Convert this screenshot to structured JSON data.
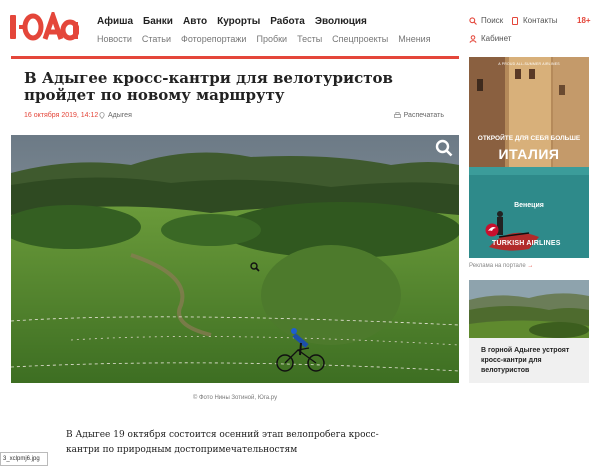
{
  "brand": {
    "logo_text": "Юга",
    "color": "#e4463a"
  },
  "nav_main": [
    "Афиша",
    "Банки",
    "Авто",
    "Курорты",
    "Работа",
    "Эволюция"
  ],
  "nav_sub": [
    "Новости",
    "Статьи",
    "Фоторепортажи",
    "Пробки",
    "Тесты",
    "Спецпроекты",
    "Мнения"
  ],
  "utilities": {
    "search": "Поиск",
    "contacts": "Контакты",
    "cabinet": "Кабинет",
    "age": "18+"
  },
  "article": {
    "title": "В Адыгее кросс-кантри для велотуристов пройдет по новому маршруту",
    "date": "16 октября 2019, 14:12",
    "region": "Адыгея",
    "print": "Распечатать",
    "photo_caption": "© Фото Нины Зотиной, Юга.ру",
    "lead": "В Адыгее 19 октября состоится осенний этап велопробега кросс-кантри по природным достопримечательностям"
  },
  "ad": {
    "small_text": "A PROUD ALL-SUMMER AIRLINES",
    "promo": "ОТКРОЙТЕ ДЛЯ СЕБЯ БОЛЬШЕ",
    "country": "ИТАЛИЯ",
    "city": "Венеция",
    "airline": "TURKISH AIRLINES",
    "link": "Реклама на портале",
    "link_arrow": "→"
  },
  "side_card": {
    "text": "В горной Адыгее устроят кросс-кантри для велотуристов"
  },
  "download_bar": {
    "filename": "3_xclpmj6.jpg"
  }
}
